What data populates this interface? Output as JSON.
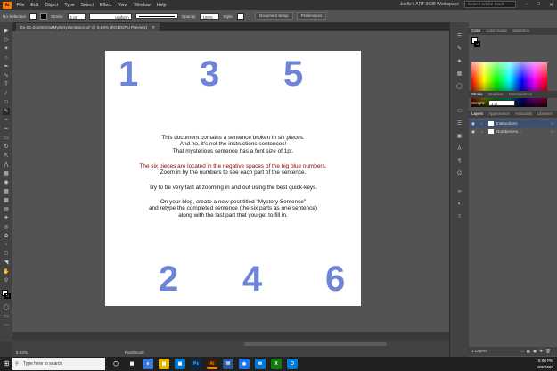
{
  "menubar": {
    "logo": "Ai",
    "items": [
      "File",
      "Edit",
      "Object",
      "Type",
      "Select",
      "Effect",
      "View",
      "Window",
      "Help"
    ],
    "workspace": "Joelle's ART 3638 Workspace",
    "search_placeholder": "Search Adobe Stock"
  },
  "controlbar": {
    "selection_label": "No Selection",
    "stroke_label": "Stroke:",
    "stroke_value": "1 pt",
    "uniform_label": "Uniform",
    "opacity_label": "Opacity:",
    "opacity_value": "100%",
    "style_label": "Style:",
    "document_setup": "Document Setup",
    "preferences": "Preferences"
  },
  "document_tab": {
    "title": "Ex-01-ZoomInOutMysterySentence.ai* @ 6.63% (RGB/GPU Preview)"
  },
  "artboard": {
    "numbers_top": [
      "1",
      "3",
      "5"
    ],
    "numbers_bottom": [
      "2",
      "4",
      "6"
    ],
    "paragraph1": [
      "This document contains a sentence broken in six pieces.",
      "And no, it's not the instructions sentences!",
      "That mysterious sentence has a font size of 1pt."
    ],
    "paragraph2": [
      "The six pieces are located in the negative spaces of the big blue numbers.",
      "Zoom in by the numbers to see each part of the sentence."
    ],
    "paragraph3": [
      "Try to be very fast at zooming in and out using the best quick-keys."
    ],
    "paragraph4": [
      "On your blog, create a new post titled \"Mystery Sentence\"",
      "and retype the completed sentence (the six parts as one sentence)",
      "along with the last part that you get to fill in."
    ]
  },
  "statusbar": {
    "zoom": "6.63%",
    "tool": "Paintbrush"
  },
  "panels": {
    "color_tabs": [
      "Color",
      "Color Guide",
      "Swatches"
    ],
    "stroke_tabs": [
      "Stroke",
      "Gradient",
      "Transparency"
    ],
    "weight_label": "Weight:",
    "weight_value": "1 pt",
    "layer_tabs": [
      "Layers",
      "Appearance",
      "Artboards",
      "Libraries"
    ],
    "layers": [
      "Instructions",
      "NumbersAn..."
    ],
    "layer_count": "2 Layers"
  },
  "taskbar": {
    "search_placeholder": "Type here to search",
    "time": "5:00 PM",
    "date": "9/3/2020"
  },
  "colors": {
    "accent_ai": "#ff7c00",
    "number_blue": "#6f84d6",
    "red_text": "#8b0000"
  }
}
